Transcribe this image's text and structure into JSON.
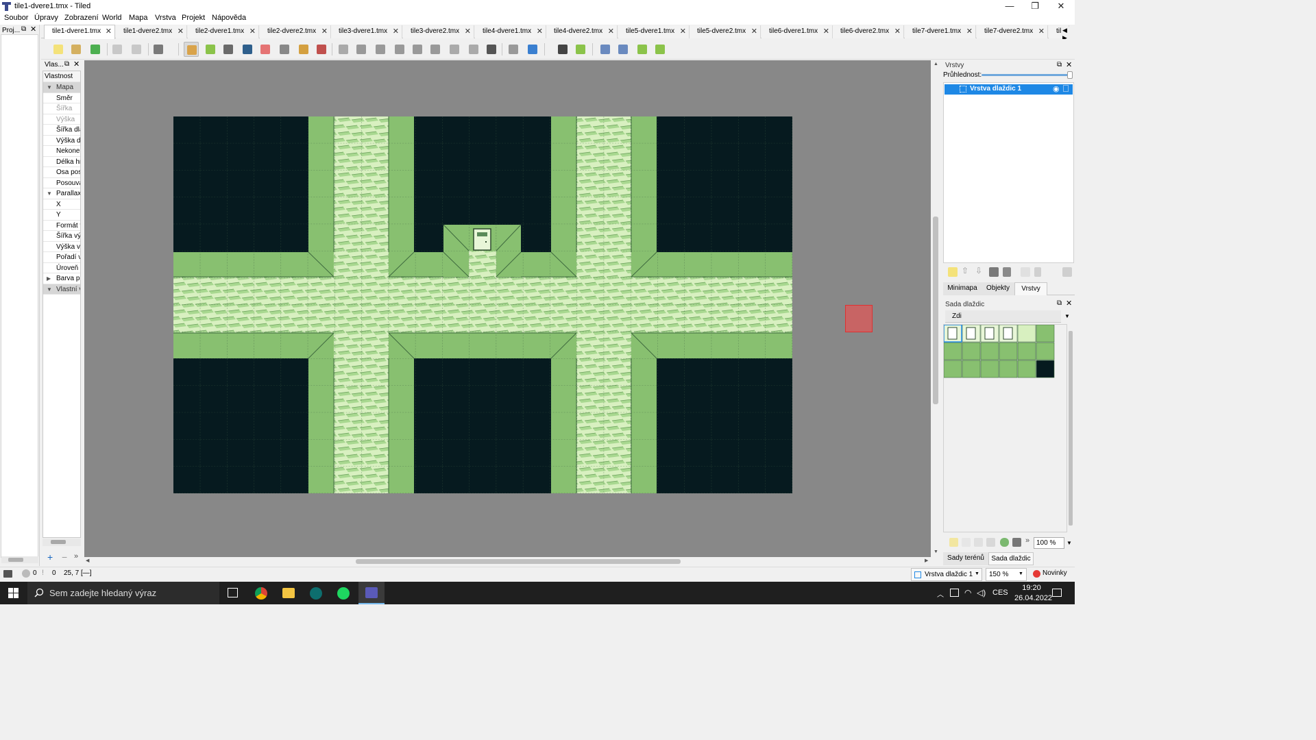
{
  "window": {
    "title": "tile1-dvere1.tmx - Tiled",
    "controls": [
      "—",
      "❐",
      "✕"
    ]
  },
  "menu": [
    "Soubor",
    "Úpravy",
    "Zobrazení",
    "World",
    "Mapa",
    "Vrstva",
    "Projekt",
    "Nápověda"
  ],
  "project_panel": {
    "title": "Proj..."
  },
  "tabs": [
    {
      "label": "tile1-dvere1.tmx",
      "active": true
    },
    {
      "label": "tile1-dvere2.tmx"
    },
    {
      "label": "tile2-dvere1.tmx"
    },
    {
      "label": "tile2-dvere2.tmx"
    },
    {
      "label": "tile3-dvere1.tmx"
    },
    {
      "label": "tile3-dvere2.tmx"
    },
    {
      "label": "tile4-dvere1.tmx"
    },
    {
      "label": "tile4-dvere2.tmx"
    },
    {
      "label": "tile5-dvere1.tmx"
    },
    {
      "label": "tile5-dvere2.tmx"
    },
    {
      "label": "tile6-dvere1.tmx"
    },
    {
      "label": "tile6-dvere2.tmx"
    },
    {
      "label": "tile7-dvere1.tmx"
    },
    {
      "label": "tile7-dvere2.tmx"
    },
    {
      "label": "til"
    }
  ],
  "properties": {
    "title": "Vlas...",
    "header": "Vlastnost",
    "rows": [
      {
        "label": "Mapa",
        "type": "group"
      },
      {
        "label": "Směr"
      },
      {
        "label": "Šířka",
        "disabled": true
      },
      {
        "label": "Výška",
        "disabled": true
      },
      {
        "label": "Šířka dla"
      },
      {
        "label": "Výška dl"
      },
      {
        "label": "Nekoneč"
      },
      {
        "label": "Délka hra"
      },
      {
        "label": "Osa posu"
      },
      {
        "label": "Posouva"
      },
      {
        "label": "Parallax",
        "expand": "▼"
      },
      {
        "label": "X"
      },
      {
        "label": "Y"
      },
      {
        "label": "Formát v"
      },
      {
        "label": "Šířka výs"
      },
      {
        "label": "Výška vý"
      },
      {
        "label": "Pořadí vy"
      },
      {
        "label": "Úroveň k"
      },
      {
        "label": "Barva po",
        "expand": "▶"
      },
      {
        "label": "Vlastní v",
        "type": "group"
      }
    ]
  },
  "layers_panel": {
    "title": "Vrstvy",
    "opacity_label": "Průhlednost:",
    "layers": [
      {
        "name": "Vrstva dlaždic 1",
        "selected": true
      }
    ],
    "tabs": [
      "Minimapa",
      "Objekty",
      "Vrstvy"
    ],
    "active_tab": "Vrstvy"
  },
  "tileset_panel": {
    "title": "Sada dlaždic",
    "selected_tileset": "Zdi",
    "zoom": "100 %",
    "bottom_tabs": [
      "Sady terénů",
      "Sada dlaždic"
    ]
  },
  "statusbar": {
    "errors": "0",
    "warnings": "0",
    "coords": "25, 7 [—]",
    "layer_select": "Vrstva dlaždic 1",
    "zoom": "150 %",
    "news": "Novinky"
  },
  "taskbar": {
    "search_placeholder": "Sem zadejte hledaný výraz",
    "language": "CES",
    "time": "19:20",
    "date": "26.04.2022"
  },
  "colors": {
    "void": "#061a1f",
    "grass": "#88c070",
    "brick_bg": "#d8f0c0",
    "brick_line": "#6aa05a",
    "canvas_bg": "#888888",
    "selection": "#1e88e5"
  }
}
